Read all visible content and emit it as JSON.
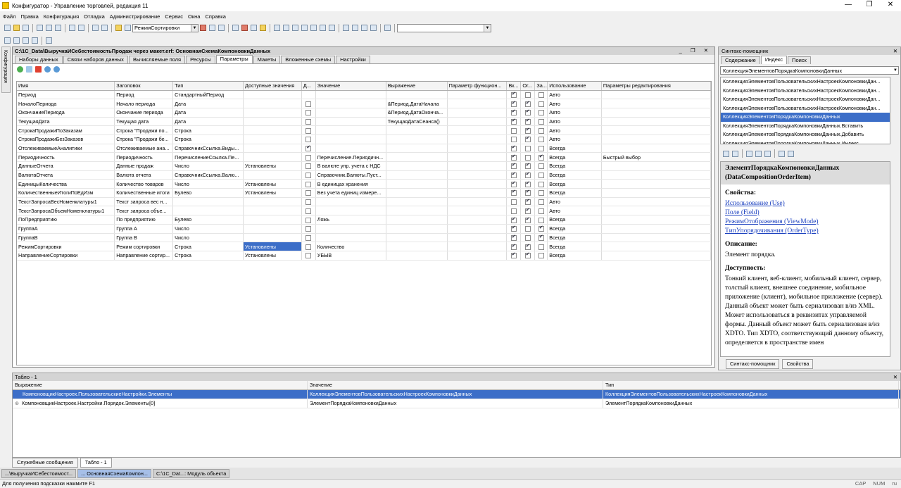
{
  "app": {
    "title": "Конфигуратор - Управление торговлей, редакция 11"
  },
  "menu": [
    "Файл",
    "Правка",
    "Конфигурация",
    "Отладка",
    "Администрирование",
    "Сервис",
    "Окна",
    "Справка"
  ],
  "toolbar": {
    "search_value": "РежимСортировки",
    "search_empty": ""
  },
  "left_tab": "Конфигурация",
  "doc": {
    "title": "C:\\1C_Data\\ВыручкаИСебестоимостьПродаж через макет.erf: ОсновнаяСхемаКомпоновкиДанных",
    "tabs": [
      "Наборы данных",
      "Связи наборов данных",
      "Вычисляемые поля",
      "Ресурсы",
      "Параметры",
      "Макеты",
      "Вложенные схемы",
      "Настройки"
    ],
    "active_tab": 4,
    "columns": [
      "Имя",
      "Заголовок",
      "Тип",
      "Доступные значения",
      "Д...",
      "Значение",
      "Выражение",
      "Параметр функцион...",
      "Вк...",
      "Ог...",
      "За...",
      "Использование",
      "Параметры редактирования"
    ],
    "rows": [
      {
        "c": [
          "Период",
          "Период",
          "СтандартныйПериод",
          "",
          "",
          "",
          "",
          "",
          "",
          "",
          "",
          "Авто",
          ""
        ],
        "b": [
          null,
          true,
          false,
          false
        ]
      },
      {
        "c": [
          "НачалоПериода",
          "Начало периода",
          "Дата",
          "",
          "",
          "",
          "&Период.ДатаНачала",
          "",
          "",
          "",
          "",
          "Авто",
          ""
        ],
        "b": [
          false,
          true,
          true,
          false
        ]
      },
      {
        "c": [
          "ОкончаниеПериода",
          "Окончание периода",
          "Дата",
          "",
          "",
          "",
          "&Период.ДатаОконча...",
          "",
          "",
          "",
          "",
          "Авто",
          ""
        ],
        "b": [
          false,
          true,
          true,
          false
        ]
      },
      {
        "c": [
          "ТекущаяДата",
          "Текущая дата",
          "Дата",
          "",
          "",
          "",
          "ТекущаяДатаСеанса()",
          "",
          "",
          "",
          "",
          "Авто",
          ""
        ],
        "b": [
          false,
          true,
          true,
          false
        ]
      },
      {
        "c": [
          "СтрокаПродажиПоЗаказам",
          "Строка \"Продажи по...",
          "Строка",
          "",
          "",
          "",
          "",
          "",
          "",
          "",
          "",
          "Авто",
          ""
        ],
        "b": [
          false,
          false,
          true,
          false
        ]
      },
      {
        "c": [
          "СтрокаПродажиБезЗаказов",
          "Строка \"Продажи бе...",
          "Строка",
          "",
          "",
          "",
          "",
          "",
          "",
          "",
          "",
          "Авто",
          ""
        ],
        "b": [
          false,
          false,
          true,
          false
        ]
      },
      {
        "c": [
          "ОтслеживаемыеАналитики",
          "Отслеживаемые ана...",
          "СправочникСсылка.Виды...",
          "",
          "",
          "",
          "",
          "",
          "",
          "",
          "",
          "Всегда",
          ""
        ],
        "b": [
          true,
          true,
          false,
          false
        ]
      },
      {
        "c": [
          "Периодичность",
          "Периодичность",
          "ПеречислениеСсылка.Пе...",
          "",
          "",
          "Перечисление.Периодичн...",
          "",
          "",
          "",
          "",
          "",
          "Всегда",
          "Быстрый выбор"
        ],
        "b": [
          false,
          true,
          false,
          true
        ]
      },
      {
        "c": [
          "ДанныеОтчета",
          "Данные продаж",
          "Число",
          "Установлены",
          "",
          "В валюте упр. учета с НДС",
          "",
          "",
          "",
          "",
          "",
          "Всегда",
          ""
        ],
        "b": [
          false,
          true,
          true,
          false
        ]
      },
      {
        "c": [
          "ВалютаОтчета",
          "Валюта отчета",
          "СправочникСсылка.Валю...",
          "",
          "",
          "Справочник.Валюты.Пуст...",
          "",
          "",
          "",
          "",
          "",
          "Всегда",
          ""
        ],
        "b": [
          false,
          true,
          true,
          false
        ]
      },
      {
        "c": [
          "ЕдиницыКоличества",
          "Количество товаров",
          "Число",
          "Установлены",
          "",
          "В единицах хранения",
          "",
          "",
          "",
          "",
          "",
          "Всегда",
          ""
        ],
        "b": [
          false,
          true,
          true,
          false
        ]
      },
      {
        "c": [
          "КоличественныеИтогиПоЕдИзм",
          "Количественные итоги",
          "Булево",
          "Установлены",
          "",
          "Без учета единиц измере...",
          "",
          "",
          "",
          "",
          "",
          "Всегда",
          ""
        ],
        "b": [
          false,
          true,
          true,
          false
        ]
      },
      {
        "c": [
          "ТекстЗапросаВесНоменклатуры1",
          "Текст запроса вес н...",
          "",
          "",
          "",
          "",
          "",
          "",
          "",
          "",
          "",
          "Авто",
          ""
        ],
        "b": [
          false,
          false,
          true,
          false
        ]
      },
      {
        "c": [
          "ТекстЗапросаОбъемНоменклатуры1",
          "Текст запроса объе...",
          "",
          "",
          "",
          "",
          "",
          "",
          "",
          "",
          "",
          "Авто",
          ""
        ],
        "b": [
          false,
          false,
          true,
          false
        ]
      },
      {
        "c": [
          "ПоПредприятию",
          "По предприятию",
          "Булево",
          "",
          "",
          "Ложь",
          "",
          "",
          "",
          "",
          "",
          "Всегда",
          ""
        ],
        "b": [
          false,
          true,
          true,
          false
        ]
      },
      {
        "c": [
          "ГруппаА",
          "Группа А",
          "Число",
          "",
          "",
          "",
          "",
          "",
          "",
          "",
          "",
          "Всегда",
          ""
        ],
        "b": [
          false,
          true,
          false,
          true
        ]
      },
      {
        "c": [
          "ГруппаВ",
          "Группа В",
          "Число",
          "",
          "",
          "",
          "",
          "",
          "",
          "",
          "",
          "Всегда",
          ""
        ],
        "b": [
          false,
          true,
          false,
          true
        ]
      },
      {
        "c": [
          "РежимСортировки",
          "Режим сортировки",
          "Строка",
          "Установлены",
          "",
          "Количество",
          "",
          "",
          "",
          "",
          "",
          "Всегда",
          ""
        ],
        "b": [
          false,
          true,
          true,
          false
        ],
        "sel": 3
      },
      {
        "c": [
          "НаправлениеСортировки",
          "Направление сортир...",
          "Строка",
          "Установлены",
          "",
          "УБЫВ",
          "",
          "",
          "",
          "",
          "",
          "Всегда",
          ""
        ],
        "b": [
          false,
          true,
          true,
          false
        ]
      }
    ]
  },
  "syntax": {
    "title": "Синтакс-помощник",
    "tabs": [
      "Содержание",
      "Индекс",
      "Поиск"
    ],
    "search": "КоллекцияЭлементовПорядкаКомпоновкиДанных",
    "list": [
      "КоллекцияЭлементовПользовательскихНастроекКомпоновкиДан...",
      "КоллекцияЭлементовПользовательскихНастроекКомпоновкиДан...",
      "КоллекцияЭлементовПользовательскихНастроекКомпоновкиДан...",
      "КоллекцияЭлементовПользовательскихНастроекКомпоновкиДан...",
      "КоллекцияЭлементовПорядкаКомпоновкиДанных",
      "КоллекцияЭлементовПорядкаКомпоновкиДанных.Вставить",
      "КоллекцияЭлементовПорядкаКомпоновкиДанных.Добавить",
      "КоллекцияЭлементовПорядкаКомпоновкиДанных.Индекс"
    ],
    "selected": 4,
    "help_title": "ЭлементПорядкаКомпоновкиДанных (DataCompositionOrderItem)",
    "props_label": "Свойства:",
    "props": [
      "Использование (Use)",
      "Поле (Field)",
      "РежимОтображения (ViewMode)",
      "ТипУпорядочивания (OrderType)"
    ],
    "desc_label": "Описание:",
    "desc": "Элемент порядка.",
    "avail_label": "Доступность:",
    "avail": "Тонкий клиент, веб-клиент, мобильный клиент, сервер, толстый клиент, внешнее соединение, мобильное приложение (клиент), мобильное приложение (сервер).",
    "serial": "Данный объект может быть сериализован в/из XML. Может использоваться в реквизитах управляемой формы. Данный объект может быть сериализован в/из XDTO. Тип XDTO, соответствующий данному объекту, определяется в пространстве имен",
    "bottom_tabs": [
      "Синтакс-помощник",
      "Свойства"
    ]
  },
  "table": {
    "title": "Табло - 1",
    "headers": [
      "Выражение",
      "Значение",
      "Тип"
    ],
    "rows": [
      [
        "КомпоновщикНастроек.ПользовательскиеНастройки.Элементы",
        "КоллекцияЭлементовПользовательскихНастроекКомпоновкиДанных",
        "КоллекцияЭлементовПользовательскихНастроекКомпоновкиДанных"
      ],
      [
        "КомпоновщикНастроек.Настройки.Порядок.Элементы[0]",
        "ЭлементПорядкаКомпоновкиДанных",
        "ЭлементПорядкаКомпоновкиДанных"
      ]
    ]
  },
  "bottom_tabs": [
    "Служебные сообщения",
    "Табло - 1"
  ],
  "taskbar": [
    "...\\ВыручкаИСебестоимост...",
    "... ОсновнаяСхемаКомпон...",
    "C:\\1C_Dat...: Модуль объекта"
  ],
  "status": {
    "hint": "Для получения подсказки нажмите F1",
    "caps": "CAP",
    "num": "NUM",
    "lang": "ru"
  }
}
